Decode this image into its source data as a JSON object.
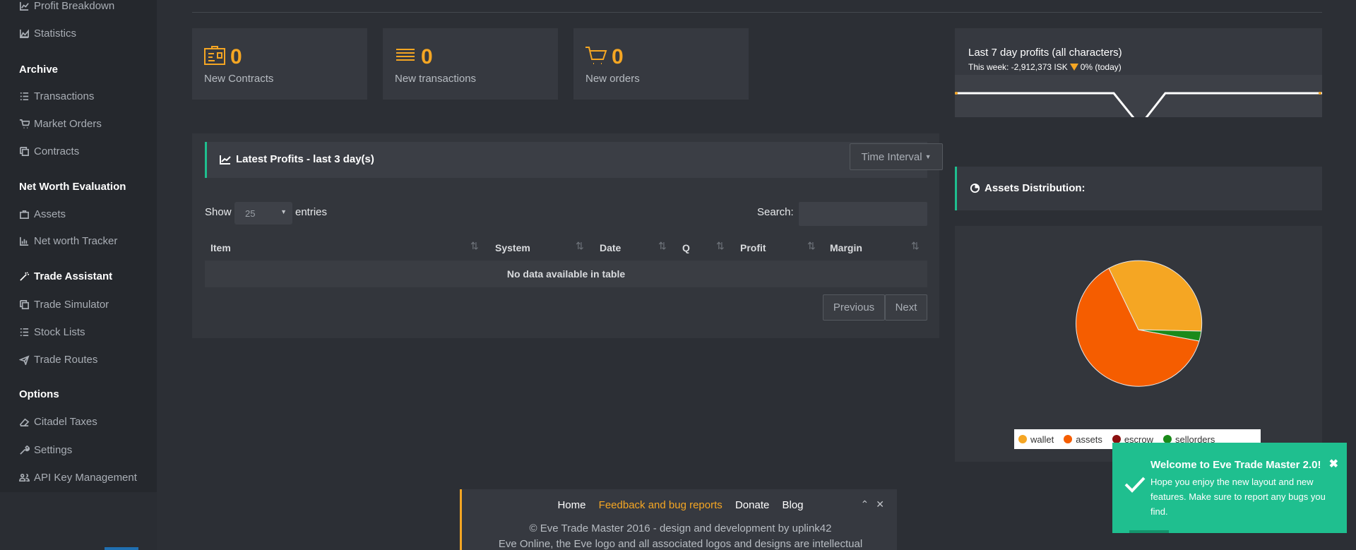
{
  "sidebar": {
    "items": [
      {
        "label": "Profit Breakdown",
        "icon": "line-chart-icon"
      },
      {
        "label": "Statistics",
        "icon": "area-chart-icon"
      }
    ],
    "archive_heading": "Archive",
    "archive": [
      {
        "label": "Transactions",
        "icon": "list-icon"
      },
      {
        "label": "Market Orders",
        "icon": "cart-icon"
      },
      {
        "label": "Contracts",
        "icon": "copy-icon"
      }
    ],
    "networth_heading": "Net Worth Evaluation",
    "networth": [
      {
        "label": "Assets",
        "icon": "briefcase-icon"
      },
      {
        "label": "Net worth Tracker",
        "icon": "bar-chart-icon"
      }
    ],
    "trade_heading": "Trade Assistant",
    "trade": [
      {
        "label": "Trade Simulator",
        "icon": "copy-icon"
      },
      {
        "label": "Stock Lists",
        "icon": "list-icon"
      },
      {
        "label": "Trade Routes",
        "icon": "plane-icon"
      }
    ],
    "options_heading": "Options",
    "options": [
      {
        "label": "Citadel Taxes",
        "icon": "eraser-icon"
      },
      {
        "label": "Settings",
        "icon": "wrench-icon"
      },
      {
        "label": "API Key Management",
        "icon": "users-icon"
      }
    ]
  },
  "stats": [
    {
      "value": "0",
      "label": "New Contracts",
      "icon": "id-card-icon"
    },
    {
      "value": "0",
      "label": "New transactions",
      "icon": "list-lines-icon"
    },
    {
      "value": "0",
      "label": "New orders",
      "icon": "cart-icon"
    }
  ],
  "profits": {
    "title": "Latest Profits - last 3 day(s)",
    "time_interval": "Time Interval",
    "show_label": "Show",
    "page_size": "25",
    "entries_label": "entries",
    "search_label": "Search:",
    "columns": [
      "Item",
      "System",
      "Date",
      "Q",
      "Profit",
      "Margin"
    ],
    "empty": "No data available in table",
    "previous": "Previous",
    "next": "Next"
  },
  "weekly": {
    "title": "Last 7 day profits (all characters)",
    "week_prefix": "This week: -2,912,373 ISK",
    "week_suffix": "0% (today)",
    "trend_color": "#f5a623"
  },
  "assets": {
    "title": "Assets Distribution:",
    "legend": [
      {
        "label": "wallet",
        "color": "#f5a623"
      },
      {
        "label": "assets",
        "color": "#f55d00"
      },
      {
        "label": "escrow",
        "color": "#8b1010"
      },
      {
        "label": "sellorders",
        "color": "#1a8a1a"
      }
    ]
  },
  "footer": {
    "links": [
      "Home",
      "Feedback and bug reports",
      "Donate",
      "Blog"
    ],
    "copyright": "© Eve Trade Master 2016 - design and development by uplink42",
    "legal": "Eve Online, the Eve logo and all associated logos and designs are intellectual"
  },
  "toast": {
    "title": "Welcome to Eve Trade Master 2.0!",
    "text": "Hope you enjoy the new layout and new features. Make sure to report any bugs you find."
  },
  "colors": {
    "accent": "#f5a623",
    "success": "#1fbf8f",
    "bg": "#2c2f35"
  }
}
